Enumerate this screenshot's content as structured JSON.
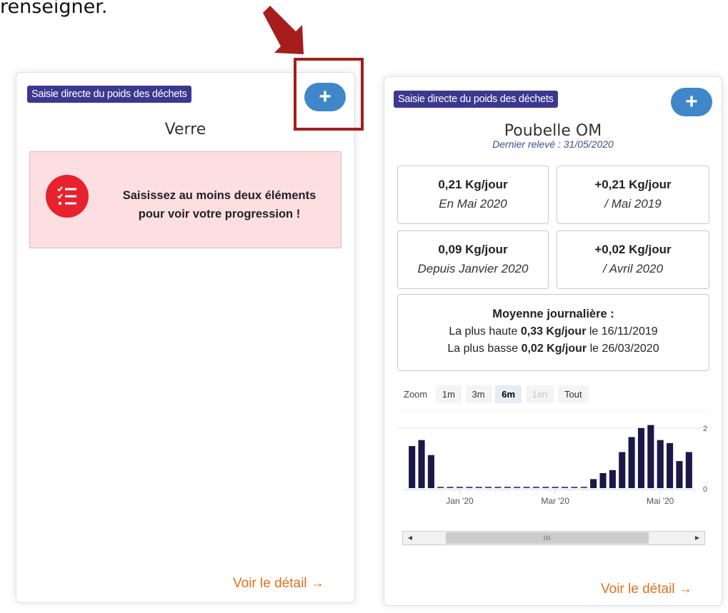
{
  "intro_text": "renseigner.",
  "colors": {
    "accent_blue": "#3f87c9",
    "badge": "#3c3890",
    "link_orange": "#e2701c",
    "bar": "#1c1748",
    "annotation_red": "#a51d1d"
  },
  "card_left": {
    "badge": "Saisie directe du poids des déchets",
    "add_icon": "plus-icon",
    "add_label": "+",
    "title": "Verre",
    "alert_icon": "checklist-icon",
    "alert_text": "Saisissez au moins deux éléments pour voir votre progression !",
    "detail_link": "Voir le détail →"
  },
  "card_right": {
    "badge": "Saisie directe du poids des déchets",
    "add_icon": "plus-icon",
    "add_label": "+",
    "title": "Poubelle OM",
    "subtitle": "Dernier relevé : 31/05/2020",
    "stats": [
      {
        "value": "0,21 Kg/jour",
        "label": "En Mai 2020"
      },
      {
        "value": "+0,21 Kg/jour",
        "label": "/ Mai 2019"
      },
      {
        "value": "0,09 Kg/jour",
        "label": "Depuis Janvier 2020"
      },
      {
        "value": "+0,02 Kg/jour",
        "label": "/ Avril 2020"
      }
    ],
    "average": {
      "heading": "Moyenne journalière :",
      "high_prefix": "La plus haute",
      "high_value": "0,33 Kg/jour",
      "high_suffix": "le 16/11/2019",
      "low_prefix": "La plus basse",
      "low_value": "0,02 Kg/jour",
      "low_suffix": "le 26/03/2020"
    },
    "zoom": {
      "label": "Zoom",
      "options": [
        "1m",
        "3m",
        "6m",
        "1an",
        "Tout"
      ],
      "selected": "6m",
      "disabled": [
        "1an"
      ]
    },
    "scrollbar": {
      "left_icon": "arrow-left-icon",
      "left_glyph": "◀",
      "right_icon": "arrow-right-icon",
      "right_glyph": "▶",
      "thumb_grip": "III"
    },
    "detail_link": "Voir le détail →"
  },
  "chart_data": {
    "type": "bar",
    "y_ticks": [
      "0",
      "2"
    ],
    "ylim": [
      0,
      2.4
    ],
    "x_tick_labels": [
      "Jan '20",
      "Mar '20",
      "Mai '20"
    ],
    "values": [
      1.4,
      1.6,
      1.1,
      0,
      0,
      0,
      0,
      0,
      0,
      0,
      0,
      0,
      0,
      0,
      0,
      0,
      0,
      0,
      0,
      0.3,
      0.5,
      0.6,
      1.2,
      1.7,
      2.0,
      2.1,
      1.6,
      1.5,
      0.9,
      1.2
    ],
    "tick_indices": [
      5,
      15,
      26
    ],
    "zero_line_style": "dashed"
  }
}
